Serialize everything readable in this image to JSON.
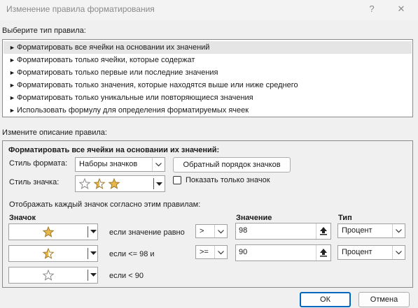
{
  "dialog": {
    "title": "Изменение правила форматирования",
    "help": "?",
    "close": "✕"
  },
  "rule_type": {
    "label": "Выберите тип правила:",
    "items": [
      "Форматировать все ячейки на основании их значений",
      "Форматировать только ячейки, которые содержат",
      "Форматировать только первые или последние значения",
      "Форматировать только значения, которые находятся выше или ниже среднего",
      "Форматировать только уникальные или повторяющиеся значения",
      "Использовать формулу для определения форматируемых ячеек"
    ],
    "selected_index": 0
  },
  "description": {
    "label": "Измените описание правила:",
    "heading": "Форматировать все ячейки на основании их значений:",
    "format_style_label": "Стиль формата:",
    "format_style_value": "Наборы значков",
    "reverse_button": "Обратный порядок значков",
    "icon_style_label": "Стиль значка:",
    "icon_style_value": "3 stars",
    "show_icon_only_label": "Показать только значок",
    "show_icon_only_checked": false,
    "rules_caption": "Отображать каждый значок согласно этим правилам:",
    "col_icon": "Значок",
    "col_value": "Значение",
    "col_type": "Тип",
    "rules": [
      {
        "icon": "star-full-icon",
        "condition": "если значение равно",
        "operator": ">",
        "value": "98",
        "type": "Процент"
      },
      {
        "icon": "star-half-icon",
        "condition": "если <= 98 и",
        "operator": ">=",
        "value": "90",
        "type": "Процент"
      },
      {
        "icon": "star-empty-icon",
        "condition": "если < 90"
      }
    ]
  },
  "buttons": {
    "ok": "ОК",
    "cancel": "Отмена"
  },
  "colors": {
    "star_fill": "#e8b84a",
    "star_stroke": "#a07a2a",
    "selected_row": "#e5e5e5"
  }
}
